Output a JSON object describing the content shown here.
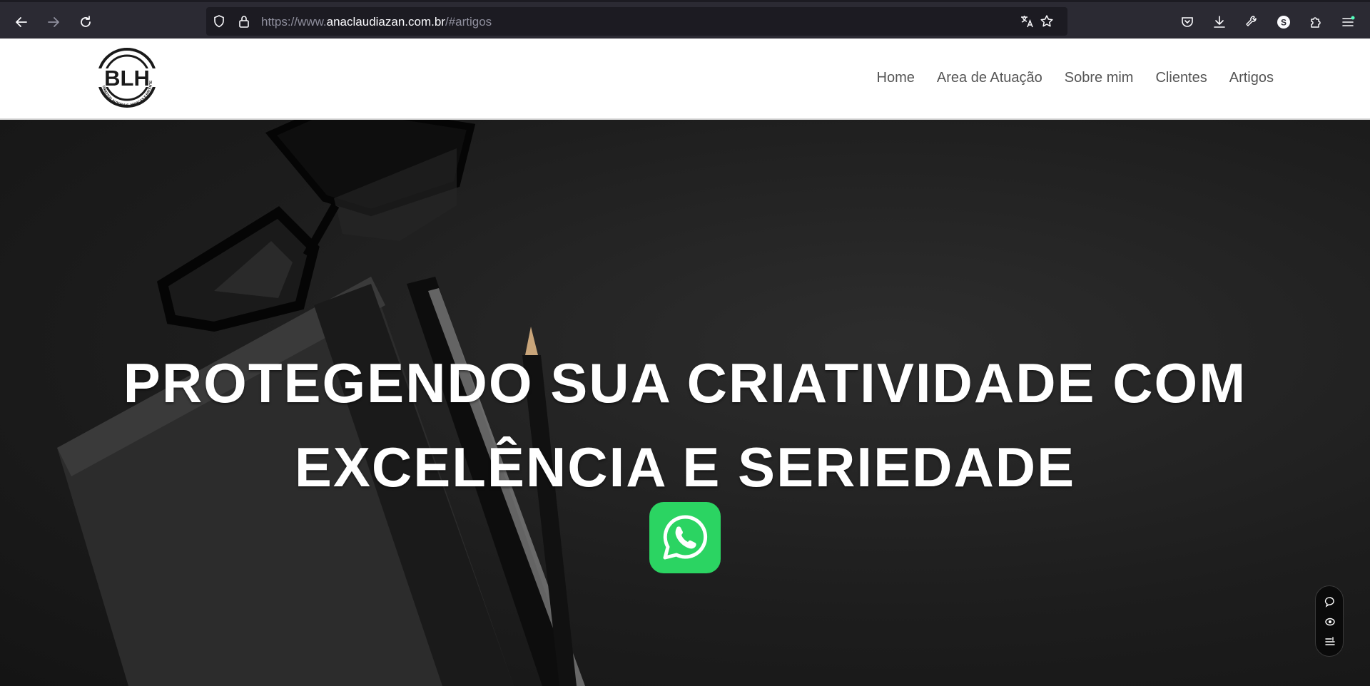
{
  "browser": {
    "url_prefix": "https://www.",
    "url_host": "anaclaudiazan.com.br",
    "url_suffix": "/#artigos",
    "icons": [
      "back-icon",
      "forward-icon",
      "reload-icon",
      "shield-icon",
      "lock-icon",
      "translate-icon",
      "bookmark-star-icon",
      "pocket-icon",
      "download-icon",
      "wrench-icon",
      "account-icon",
      "extensions-icon",
      "menu-icon"
    ],
    "account_letter": "S"
  },
  "site": {
    "logo_text": "BLH",
    "logo_ring_text": "DIREITOS AUTORAIS, MARCAS E PATENTES",
    "nav": [
      {
        "label": "Home"
      },
      {
        "label": "Area de Atuação"
      },
      {
        "label": "Sobre mim"
      },
      {
        "label": "Clientes"
      },
      {
        "label": "Artigos"
      }
    ]
  },
  "hero": {
    "headline_line1": "PROTEGENDO SUA CRIATIVIDADE COM",
    "headline_line2": "EXCELÊNCIA E SERIEDADE",
    "whatsapp_icon": "whatsapp-icon"
  },
  "side_widget": {
    "icons": [
      "chat-icon",
      "eye-icon",
      "settings-list-icon"
    ]
  },
  "colors": {
    "browser_toolbar": "#2b2a33",
    "url_field": "#1c1b22",
    "header_bg": "#ffffff",
    "nav_text": "#555555",
    "whatsapp_green": "#2bd462",
    "hero_text": "#ffffff"
  }
}
